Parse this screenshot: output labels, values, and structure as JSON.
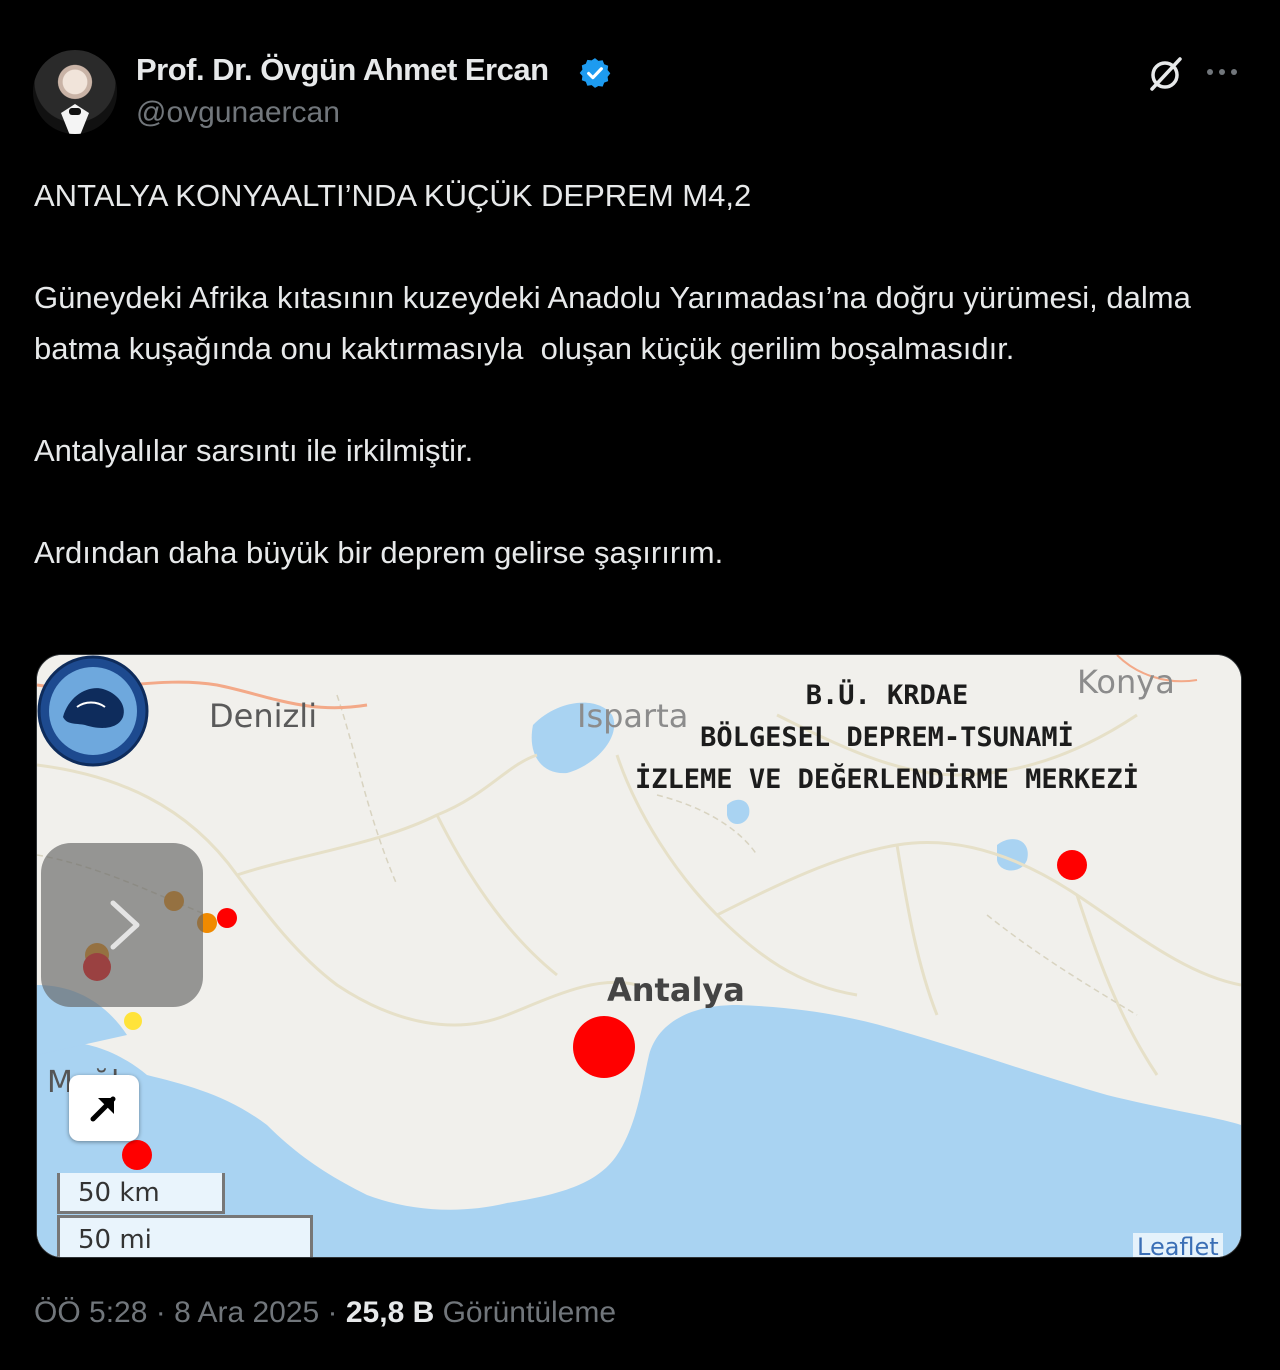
{
  "author": {
    "name": "Prof. Dr. Övgün Ahmet Ercan",
    "handle": "@ovgunaercan",
    "verified": true,
    "avatar_icon": "profile-photo"
  },
  "actions": {
    "grok_icon": "grok-slash-circle-icon",
    "more_icon": "more-dots-icon"
  },
  "tweet": {
    "text": "ANTALYA KONYAALTI’NDA KÜÇÜK DEPREM M4,2\n\nGüneydeki Afrika kıtasının kuzeydeki Anadolu Yarımadası’na doğru yürümesi, dalma batma kuşağında onu kaktırmasıyla  oluşan küçük gerilim boşalmasıdır.\n\nAntalyalılar sarsıntı ile irkilmiştir.\n\nArdından daha büyük bir deprem gelirse şaşırırım."
  },
  "map": {
    "header_line1": "B.Ü. KRDAE",
    "header_line2": "BÖLGESEL DEPREM-TSUNAMİ",
    "header_line3": "İZLEME VE DEĞERLENDİRME MERKEZİ",
    "cities": {
      "denizli": "Denizli",
      "isparta": "Isparta",
      "konya": "Konya",
      "antalya": "Antalya",
      "mugla": "Muğla"
    },
    "scale_km": "50 km",
    "scale_mi": "50 mi",
    "attribution": "Leaflet",
    "colors": {
      "sea": "#a9d3f2",
      "land": "#f1f0ec",
      "quake_red": "#ff0000",
      "quake_orange": "#f08a00",
      "quake_yellow": "#ffe33a"
    }
  },
  "meta": {
    "time": "ÖÖ 5:28",
    "separator1": " · ",
    "date": "8 Ara 2025",
    "separator2": " · ",
    "views_count": "25,8 B",
    "views_label": " Görüntüleme"
  }
}
